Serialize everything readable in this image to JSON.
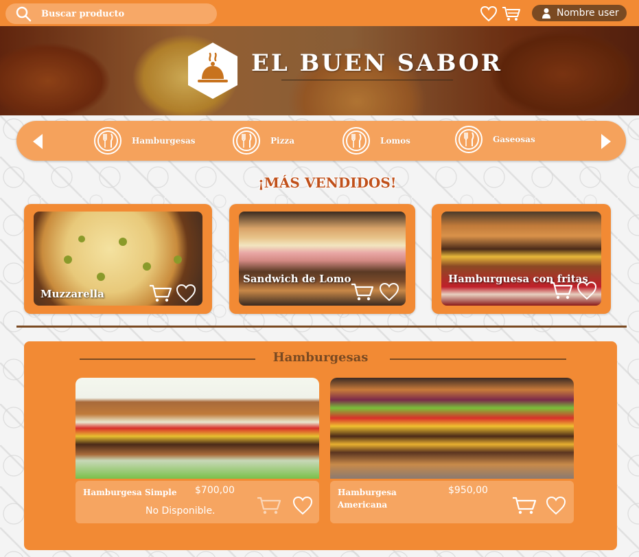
{
  "header": {
    "search_placeholder": "Buscar producto",
    "user_label": "Nombre user"
  },
  "hero": {
    "brand": "EL BUEN SABOR"
  },
  "categories": [
    {
      "label": "Hamburgesas"
    },
    {
      "label": "Pizza"
    },
    {
      "label": "Lomos"
    },
    {
      "label": "Gaseosas"
    }
  ],
  "best_sellers": {
    "title": "¡MÁS VENDIDOS!",
    "items": [
      {
        "name": "Muzzarella"
      },
      {
        "name": "Sandwich de Lomo"
      },
      {
        "name": "Hamburguesa con fritas"
      }
    ]
  },
  "section": {
    "title": "Hamburgesas",
    "products": [
      {
        "name": "Hamburgesa Simple",
        "price": "$700,00",
        "status": "No Disponible."
      },
      {
        "name": "Hamburgesa Americana",
        "price": "$950,00",
        "status": ""
      }
    ]
  },
  "colors": {
    "primary": "#f28a34",
    "light": "#f5a25c",
    "dark": "#7a4a22",
    "title_red": "#c0501a"
  },
  "icons": [
    "search-icon",
    "heart-icon",
    "cart-icon",
    "user-icon",
    "chevron-left-icon",
    "chevron-right-icon",
    "cutlery-icon",
    "cloche-icon"
  ]
}
